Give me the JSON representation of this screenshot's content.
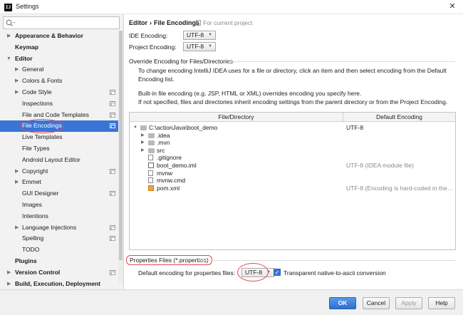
{
  "window": {
    "title": "Settings",
    "close_glyph": "✕",
    "app_icon_text": "IJ"
  },
  "sidebar": {
    "search": {
      "value": "",
      "icon": "search-icon"
    },
    "items": [
      {
        "label": "Appearance & Behavior",
        "level": 0,
        "arrow": "▶",
        "project": false
      },
      {
        "label": "Keymap",
        "level": 0,
        "arrow": "",
        "project": false
      },
      {
        "label": "Editor",
        "level": 0,
        "arrow": "▼",
        "project": false
      },
      {
        "label": "General",
        "level": 1,
        "arrow": "▶",
        "project": false
      },
      {
        "label": "Colors & Fonts",
        "level": 1,
        "arrow": "▶",
        "project": false
      },
      {
        "label": "Code Style",
        "level": 1,
        "arrow": "▶",
        "project": true
      },
      {
        "label": "Inspections",
        "level": 1,
        "arrow": "",
        "project": true
      },
      {
        "label": "File and Code Templates",
        "level": 1,
        "arrow": "",
        "project": true
      },
      {
        "label": "File Encodings",
        "level": 1,
        "arrow": "",
        "project": true,
        "selected": true
      },
      {
        "label": "Live Templates",
        "level": 1,
        "arrow": "",
        "project": false
      },
      {
        "label": "File Types",
        "level": 1,
        "arrow": "",
        "project": false
      },
      {
        "label": "Android Layout Editor",
        "level": 1,
        "arrow": "",
        "project": false
      },
      {
        "label": "Copyright",
        "level": 1,
        "arrow": "▶",
        "project": true
      },
      {
        "label": "Emmet",
        "level": 1,
        "arrow": "▶",
        "project": false
      },
      {
        "label": "GUI Designer",
        "level": 1,
        "arrow": "",
        "project": true
      },
      {
        "label": "Images",
        "level": 1,
        "arrow": "",
        "project": false
      },
      {
        "label": "Intentions",
        "level": 1,
        "arrow": "",
        "project": false
      },
      {
        "label": "Language Injections",
        "level": 1,
        "arrow": "▶",
        "project": true
      },
      {
        "label": "Spelling",
        "level": 1,
        "arrow": "",
        "project": true
      },
      {
        "label": "TODO",
        "level": 1,
        "arrow": "",
        "project": false
      },
      {
        "label": "Plugins",
        "level": 0,
        "arrow": "",
        "project": false
      },
      {
        "label": "Version Control",
        "level": 0,
        "arrow": "▶",
        "project": true
      },
      {
        "label": "Build, Execution, Deployment",
        "level": 0,
        "arrow": "▶",
        "project": false
      }
    ]
  },
  "content": {
    "breadcrumb": {
      "parent": "Editor",
      "sep": "›",
      "current": "File Encodings",
      "note": "For current project"
    },
    "ide_encoding": {
      "label": "IDE Encoding:",
      "value": "UTF-8"
    },
    "project_encoding": {
      "label": "Project Encoding:",
      "value": "UTF-8"
    },
    "override_section": "Override Encoding for Files/Directories",
    "info1": "To change encoding IntelliJ IDEA uses for a file or directory, click an item and then select encoding from the Default Encoding list.",
    "info2": "Built-in file encoding (e.g. JSP, HTML or XML) overrides encoding you specify here.",
    "info3": "If not specified, files and directories inherit encoding settings from the parent directory or from the Project Encoding.",
    "table": {
      "col_file": "File/Directory",
      "col_enc": "Default Encoding",
      "rows": [
        {
          "name": "C:\\actionJava\\boot_demo",
          "enc": "UTF-8",
          "depth": 0,
          "toggle": "▼",
          "icon": "folder-icon",
          "enc_gray": false
        },
        {
          "name": ".idea",
          "enc": "",
          "depth": 1,
          "toggle": "▶",
          "icon": "folder-icon",
          "enc_gray": false
        },
        {
          "name": ".mvn",
          "enc": "",
          "depth": 1,
          "toggle": "▶",
          "icon": "folder-icon",
          "enc_gray": false
        },
        {
          "name": "src",
          "enc": "",
          "depth": 1,
          "toggle": "▶",
          "icon": "folder-icon",
          "enc_gray": false
        },
        {
          "name": ".gitignore",
          "enc": "",
          "depth": 1,
          "toggle": "",
          "icon": "file-icon",
          "enc_gray": false
        },
        {
          "name": "boot_demo.iml",
          "enc": "UTF-8 (IDEA module file)",
          "depth": 1,
          "toggle": "",
          "icon": "iml-icon",
          "enc_gray": true
        },
        {
          "name": "mvnw",
          "enc": "",
          "depth": 1,
          "toggle": "",
          "icon": "file-icon",
          "enc_gray": false
        },
        {
          "name": "mvnw.cmd",
          "enc": "",
          "depth": 1,
          "toggle": "",
          "icon": "file-icon",
          "enc_gray": false
        },
        {
          "name": "pom.xml",
          "enc": "UTF-8 (Encoding is hard-coded in the text)",
          "depth": 1,
          "toggle": "",
          "icon": "xml-icon",
          "enc_gray": true
        }
      ]
    },
    "properties": {
      "title": "Properties Files (*.properties)",
      "default_label": "Default encoding for properties files:",
      "default_value": "UTF-8",
      "transparent_label": "Transparent native-to-ascii conversion",
      "transparent_checked": true
    }
  },
  "footer": {
    "ok": "OK",
    "cancel": "Cancel",
    "apply": "Apply",
    "help": "Help"
  },
  "colors": {
    "selection": "#3875d7",
    "annotation_red": "#e8484f",
    "ok_button": "#3b7de0"
  }
}
